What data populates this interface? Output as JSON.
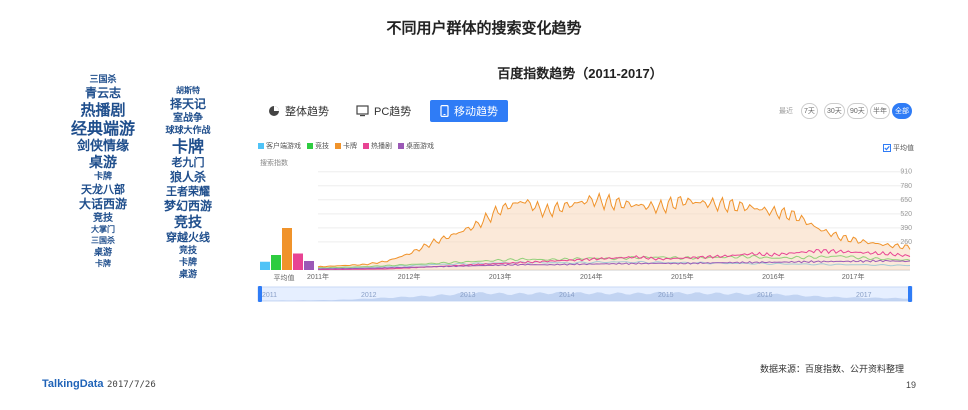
{
  "page_title": "不同用户群体的搜索变化趋势",
  "chart_title": "百度指数趋势（2011-2017）",
  "tabs": [
    {
      "label": "整体趋势",
      "icon": "pie-chart-icon"
    },
    {
      "label": "PC趋势",
      "icon": "monitor-icon"
    },
    {
      "label": "移动趋势",
      "icon": "mobile-phone-icon",
      "active": true
    }
  ],
  "range": {
    "label": "最近",
    "options": [
      "7天",
      "30天",
      "90天",
      "半年",
      "全部"
    ],
    "active": "全部"
  },
  "avg_toggle": "平均值",
  "search_index_label": "搜索指数",
  "avg_label": "平均值",
  "source": "数据来源：百度指数、公开资料整理",
  "footer": {
    "logo": "TalkingData",
    "date": "2017/7/26",
    "page": "19"
  },
  "word_cloud": {
    "left": [
      {
        "t": "三国杀",
        "s": 9
      },
      {
        "t": "青云志",
        "s": 12
      },
      {
        "t": "热播剧",
        "s": 15
      },
      {
        "t": "经典端游",
        "s": 16
      },
      {
        "t": "剑侠情缘",
        "s": 13
      },
      {
        "t": "桌游",
        "s": 14
      },
      {
        "t": "卡牌",
        "s": 9
      },
      {
        "t": "天龙八部",
        "s": 11
      },
      {
        "t": "大话西游",
        "s": 12
      },
      {
        "t": "竞技",
        "s": 10
      },
      {
        "t": "大掌门",
        "s": 8
      },
      {
        "t": "三国杀",
        "s": 8
      },
      {
        "t": "桌游",
        "s": 9
      },
      {
        "t": "卡牌",
        "s": 8
      }
    ],
    "right": [
      {
        "t": "胡斯特",
        "s": 8
      },
      {
        "t": "择天记",
        "s": 12
      },
      {
        "t": "室战争",
        "s": 10
      },
      {
        "t": "球球大作战",
        "s": 9
      },
      {
        "t": "卡牌",
        "s": 16
      },
      {
        "t": "老九门",
        "s": 11
      },
      {
        "t": "狼人杀",
        "s": 12
      },
      {
        "t": "王者荣耀",
        "s": 11
      },
      {
        "t": "梦幻西游",
        "s": 12
      },
      {
        "t": "竞技",
        "s": 14
      },
      {
        "t": "穿越火线",
        "s": 11
      },
      {
        "t": "竞技",
        "s": 9
      },
      {
        "t": "卡牌",
        "s": 9
      },
      {
        "t": "桌游",
        "s": 9
      }
    ]
  },
  "chart_data": {
    "type": "line",
    "title": "百度指数趋势（2011-2017）",
    "ylabel": "搜索指数",
    "x_ticks": [
      "2011年",
      "2012年",
      "2013年",
      "2014年",
      "2015年",
      "2016年",
      "2017年"
    ],
    "brush_ticks": [
      "2011",
      "2012",
      "2013",
      "2014",
      "2015",
      "2016",
      "2017"
    ],
    "y_ticks": [
      260,
      390,
      520,
      650,
      780,
      910
    ],
    "ylim": [
      0,
      1000
    ],
    "grid": true,
    "legend_position": "top-left",
    "x": [
      2011.0,
      2011.25,
      2011.5,
      2011.75,
      2012.0,
      2012.25,
      2012.5,
      2012.75,
      2013.0,
      2013.25,
      2013.5,
      2013.75,
      2014.0,
      2014.25,
      2014.5,
      2014.75,
      2015.0,
      2015.25,
      2015.5,
      2015.75,
      2016.0,
      2016.25,
      2016.5,
      2016.75,
      2017.0,
      2017.25,
      2017.5
    ],
    "series": [
      {
        "name": "客户端游戏",
        "color": "#4fc3f7",
        "values": [
          15,
          18,
          22,
          30,
          40,
          50,
          55,
          60,
          65,
          70,
          68,
          65,
          70,
          75,
          72,
          70,
          68,
          65,
          62,
          60,
          58,
          55,
          52,
          50,
          48,
          45,
          42
        ]
      },
      {
        "name": "竞技",
        "color": "#2ecc40",
        "values": [
          20,
          25,
          30,
          40,
          50,
          60,
          70,
          80,
          90,
          100,
          95,
          100,
          110,
          105,
          115,
          120,
          110,
          115,
          120,
          125,
          110,
          115,
          120,
          130,
          110,
          100,
          90
        ]
      },
      {
        "name": "卡牌",
        "color": "#f0932b",
        "values": [
          30,
          40,
          50,
          80,
          150,
          250,
          330,
          420,
          560,
          640,
          540,
          600,
          650,
          620,
          600,
          580,
          640,
          620,
          600,
          580,
          540,
          500,
          380,
          300,
          260,
          230,
          210
        ]
      },
      {
        "name": "热播剧",
        "color": "#e84393",
        "values": [
          5,
          5,
          8,
          10,
          20,
          30,
          40,
          50,
          60,
          70,
          80,
          90,
          100,
          110,
          120,
          100,
          110,
          120,
          130,
          150,
          140,
          160,
          180,
          170,
          160,
          150,
          130
        ]
      },
      {
        "name": "桌面游戏",
        "color": "#9b59b6",
        "values": [
          10,
          12,
          15,
          20,
          25,
          30,
          35,
          40,
          45,
          50,
          48,
          52,
          55,
          58,
          60,
          62,
          60,
          65,
          68,
          70,
          72,
          75,
          78,
          80,
          82,
          85,
          80
        ]
      }
    ],
    "average": {
      "label": "平均值",
      "values": [
        55,
        100,
        280,
        110,
        60
      ]
    }
  }
}
